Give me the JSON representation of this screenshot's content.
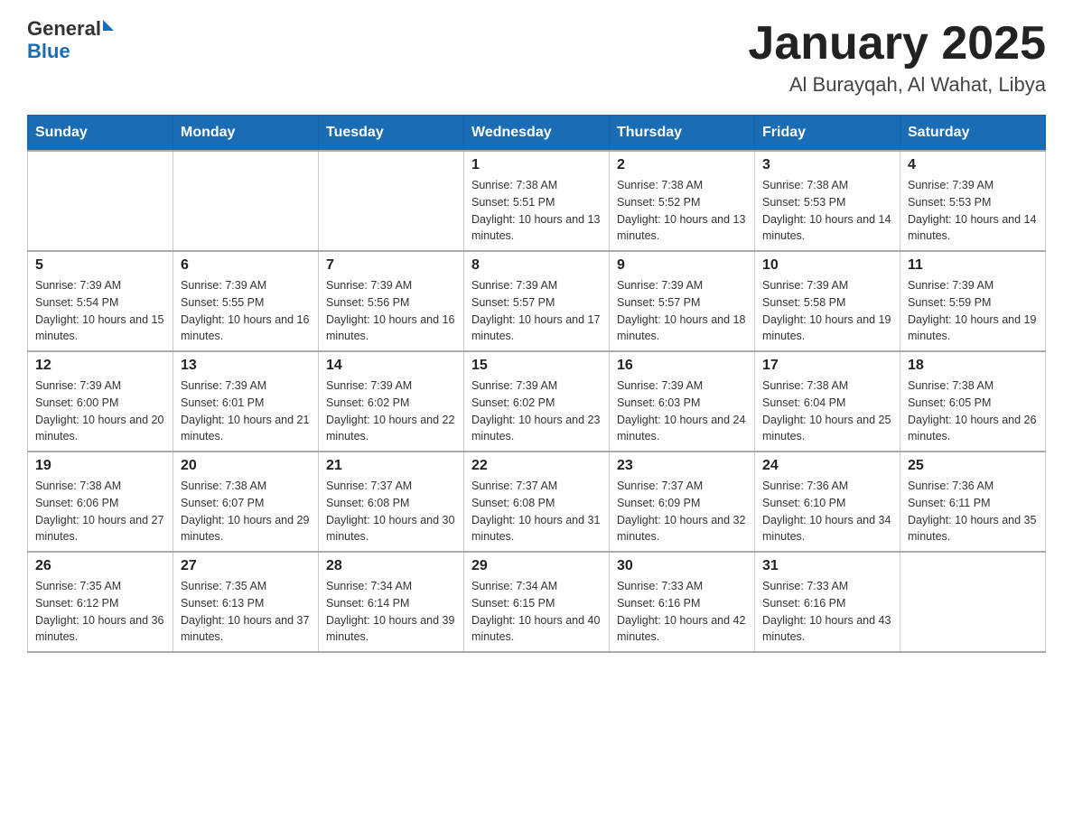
{
  "header": {
    "logo_general": "General",
    "logo_blue": "Blue",
    "month_title": "January 2025",
    "location": "Al Burayqah, Al Wahat, Libya"
  },
  "weekdays": [
    "Sunday",
    "Monday",
    "Tuesday",
    "Wednesday",
    "Thursday",
    "Friday",
    "Saturday"
  ],
  "weeks": [
    [
      {
        "day": "",
        "info": ""
      },
      {
        "day": "",
        "info": ""
      },
      {
        "day": "",
        "info": ""
      },
      {
        "day": "1",
        "info": "Sunrise: 7:38 AM\nSunset: 5:51 PM\nDaylight: 10 hours and 13 minutes."
      },
      {
        "day": "2",
        "info": "Sunrise: 7:38 AM\nSunset: 5:52 PM\nDaylight: 10 hours and 13 minutes."
      },
      {
        "day": "3",
        "info": "Sunrise: 7:38 AM\nSunset: 5:53 PM\nDaylight: 10 hours and 14 minutes."
      },
      {
        "day": "4",
        "info": "Sunrise: 7:39 AM\nSunset: 5:53 PM\nDaylight: 10 hours and 14 minutes."
      }
    ],
    [
      {
        "day": "5",
        "info": "Sunrise: 7:39 AM\nSunset: 5:54 PM\nDaylight: 10 hours and 15 minutes."
      },
      {
        "day": "6",
        "info": "Sunrise: 7:39 AM\nSunset: 5:55 PM\nDaylight: 10 hours and 16 minutes."
      },
      {
        "day": "7",
        "info": "Sunrise: 7:39 AM\nSunset: 5:56 PM\nDaylight: 10 hours and 16 minutes."
      },
      {
        "day": "8",
        "info": "Sunrise: 7:39 AM\nSunset: 5:57 PM\nDaylight: 10 hours and 17 minutes."
      },
      {
        "day": "9",
        "info": "Sunrise: 7:39 AM\nSunset: 5:57 PM\nDaylight: 10 hours and 18 minutes."
      },
      {
        "day": "10",
        "info": "Sunrise: 7:39 AM\nSunset: 5:58 PM\nDaylight: 10 hours and 19 minutes."
      },
      {
        "day": "11",
        "info": "Sunrise: 7:39 AM\nSunset: 5:59 PM\nDaylight: 10 hours and 19 minutes."
      }
    ],
    [
      {
        "day": "12",
        "info": "Sunrise: 7:39 AM\nSunset: 6:00 PM\nDaylight: 10 hours and 20 minutes."
      },
      {
        "day": "13",
        "info": "Sunrise: 7:39 AM\nSunset: 6:01 PM\nDaylight: 10 hours and 21 minutes."
      },
      {
        "day": "14",
        "info": "Sunrise: 7:39 AM\nSunset: 6:02 PM\nDaylight: 10 hours and 22 minutes."
      },
      {
        "day": "15",
        "info": "Sunrise: 7:39 AM\nSunset: 6:02 PM\nDaylight: 10 hours and 23 minutes."
      },
      {
        "day": "16",
        "info": "Sunrise: 7:39 AM\nSunset: 6:03 PM\nDaylight: 10 hours and 24 minutes."
      },
      {
        "day": "17",
        "info": "Sunrise: 7:38 AM\nSunset: 6:04 PM\nDaylight: 10 hours and 25 minutes."
      },
      {
        "day": "18",
        "info": "Sunrise: 7:38 AM\nSunset: 6:05 PM\nDaylight: 10 hours and 26 minutes."
      }
    ],
    [
      {
        "day": "19",
        "info": "Sunrise: 7:38 AM\nSunset: 6:06 PM\nDaylight: 10 hours and 27 minutes."
      },
      {
        "day": "20",
        "info": "Sunrise: 7:38 AM\nSunset: 6:07 PM\nDaylight: 10 hours and 29 minutes."
      },
      {
        "day": "21",
        "info": "Sunrise: 7:37 AM\nSunset: 6:08 PM\nDaylight: 10 hours and 30 minutes."
      },
      {
        "day": "22",
        "info": "Sunrise: 7:37 AM\nSunset: 6:08 PM\nDaylight: 10 hours and 31 minutes."
      },
      {
        "day": "23",
        "info": "Sunrise: 7:37 AM\nSunset: 6:09 PM\nDaylight: 10 hours and 32 minutes."
      },
      {
        "day": "24",
        "info": "Sunrise: 7:36 AM\nSunset: 6:10 PM\nDaylight: 10 hours and 34 minutes."
      },
      {
        "day": "25",
        "info": "Sunrise: 7:36 AM\nSunset: 6:11 PM\nDaylight: 10 hours and 35 minutes."
      }
    ],
    [
      {
        "day": "26",
        "info": "Sunrise: 7:35 AM\nSunset: 6:12 PM\nDaylight: 10 hours and 36 minutes."
      },
      {
        "day": "27",
        "info": "Sunrise: 7:35 AM\nSunset: 6:13 PM\nDaylight: 10 hours and 37 minutes."
      },
      {
        "day": "28",
        "info": "Sunrise: 7:34 AM\nSunset: 6:14 PM\nDaylight: 10 hours and 39 minutes."
      },
      {
        "day": "29",
        "info": "Sunrise: 7:34 AM\nSunset: 6:15 PM\nDaylight: 10 hours and 40 minutes."
      },
      {
        "day": "30",
        "info": "Sunrise: 7:33 AM\nSunset: 6:16 PM\nDaylight: 10 hours and 42 minutes."
      },
      {
        "day": "31",
        "info": "Sunrise: 7:33 AM\nSunset: 6:16 PM\nDaylight: 10 hours and 43 minutes."
      },
      {
        "day": "",
        "info": ""
      }
    ]
  ]
}
